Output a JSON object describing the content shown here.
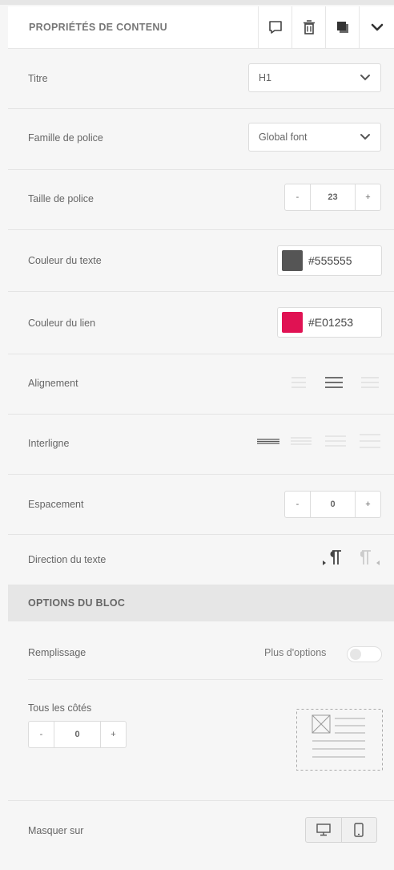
{
  "header": {
    "title": "PROPRIÉTÉS DE CONTENU",
    "icons": [
      "comment-icon",
      "trash-icon",
      "copy-icon",
      "chevron-down-icon"
    ]
  },
  "content": {
    "title_label": "Titre",
    "title_value": "H1",
    "font_family_label": "Famille de police",
    "font_family_value": "Global font",
    "font_size_label": "Taille de police",
    "font_size_value": "23",
    "text_color_label": "Couleur du texte",
    "text_color_value": "#555555",
    "link_color_label": "Couleur du lien",
    "link_color_value": "#E01253",
    "alignment_label": "Alignement",
    "line_height_label": "Interligne",
    "spacing_label": "Espacement",
    "spacing_value": "0",
    "direction_label": "Direction du texte",
    "minus": "-",
    "plus": "+"
  },
  "block_options": {
    "title": "OPTIONS DU BLOC",
    "padding_label": "Remplissage",
    "more_options_label": "Plus d'options",
    "more_options_enabled": false,
    "all_sides_label": "Tous les côtés",
    "all_sides_value": "0",
    "hide_on_label": "Masquer sur"
  },
  "colors": {
    "text_swatch": "#555555",
    "link_swatch": "#E01253"
  }
}
